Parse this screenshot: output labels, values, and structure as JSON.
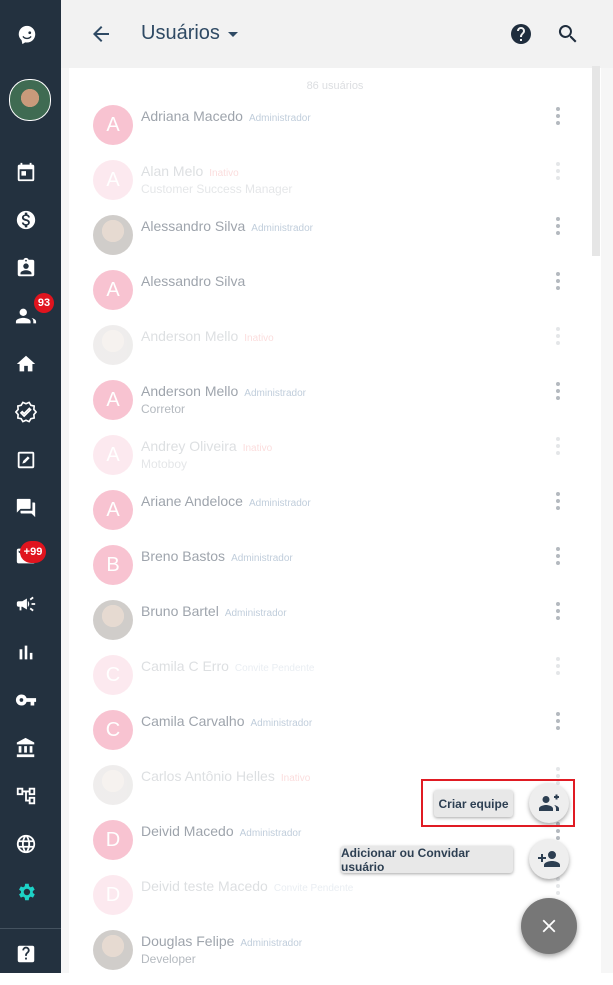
{
  "header": {
    "title": "Usuários"
  },
  "list": {
    "count_label": "86 usuários",
    "users": [
      {
        "initial": "A",
        "name": "Adriana Macedo",
        "tag": "Administrador",
        "tag_type": "role",
        "subtitle": "",
        "avatar": "letter",
        "dim": false
      },
      {
        "initial": "A",
        "name": "Alan Melo",
        "tag": "Inativo",
        "tag_type": "inactive",
        "subtitle": "Customer Success Manager",
        "avatar": "letter",
        "dim": true
      },
      {
        "initial": "",
        "name": "Alessandro Silva",
        "tag": "Administrador",
        "tag_type": "role",
        "subtitle": "",
        "avatar": "photo",
        "dim": false
      },
      {
        "initial": "A",
        "name": "Alessandro Silva",
        "tag": "",
        "tag_type": "role",
        "subtitle": "",
        "avatar": "letter",
        "dim": false
      },
      {
        "initial": "",
        "name": "Anderson Mello",
        "tag": "Inativo",
        "tag_type": "inactive",
        "subtitle": "",
        "avatar": "photo",
        "dim": true
      },
      {
        "initial": "A",
        "name": "Anderson Mello",
        "tag": "Administrador",
        "tag_type": "role",
        "subtitle": "Corretor",
        "avatar": "letter",
        "dim": false
      },
      {
        "initial": "A",
        "name": "Andrey Oliveira",
        "tag": "Inativo",
        "tag_type": "inactive",
        "subtitle": "Motoboy",
        "avatar": "letter",
        "dim": true
      },
      {
        "initial": "A",
        "name": "Ariane Andeloce",
        "tag": "Administrador",
        "tag_type": "role",
        "subtitle": "",
        "avatar": "letter",
        "dim": false
      },
      {
        "initial": "B",
        "name": "Breno Bastos",
        "tag": "Administrador",
        "tag_type": "role",
        "subtitle": "",
        "avatar": "letter",
        "dim": false
      },
      {
        "initial": "",
        "name": "Bruno Bartel",
        "tag": "Administrador",
        "tag_type": "role",
        "subtitle": "",
        "avatar": "photo",
        "dim": false
      },
      {
        "initial": "C",
        "name": "Camila C Erro",
        "tag": "Convite Pendente",
        "tag_type": "role",
        "subtitle": "",
        "avatar": "letter",
        "dim": true
      },
      {
        "initial": "C",
        "name": "Camila Carvalho",
        "tag": "Administrador",
        "tag_type": "role",
        "subtitle": "",
        "avatar": "letter",
        "dim": false
      },
      {
        "initial": "",
        "name": "Carlos Antônio Helles",
        "tag": "Inativo",
        "tag_type": "inactive",
        "subtitle": "",
        "avatar": "photo",
        "dim": true
      },
      {
        "initial": "D",
        "name": "Deivid Macedo",
        "tag": "Administrador",
        "tag_type": "role",
        "subtitle": "",
        "avatar": "letter",
        "dim": false
      },
      {
        "initial": "D",
        "name": "Deivid teste Macedo",
        "tag": "Convite Pendente",
        "tag_type": "role",
        "subtitle": "",
        "avatar": "letter",
        "dim": true
      },
      {
        "initial": "",
        "name": "Douglas Felipe",
        "tag": "Administrador",
        "tag_type": "role",
        "subtitle": "Developer",
        "avatar": "photo",
        "dim": false
      }
    ]
  },
  "sidebar": {
    "badge_contacts": "93",
    "badge_messages": "+99"
  },
  "speed_dial": {
    "create_team_label": "Criar equipe",
    "add_user_label": "Adicionar ou Convidar usuário"
  },
  "colors": {
    "sidebar": "#23313f",
    "accent": "#2f4a64",
    "highlight": "#e01b23",
    "avatar": "#f5a3b8",
    "settings_icon": "#1dd3c7"
  }
}
